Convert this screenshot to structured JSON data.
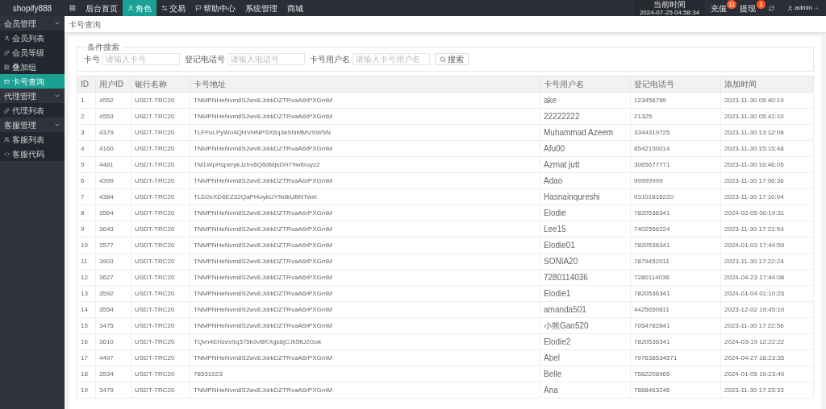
{
  "top_nav": {
    "brand": "shopify888",
    "items": [
      {
        "label": "后台首页",
        "selected": false
      },
      {
        "label": "角色",
        "selected": true
      },
      {
        "label": "交易",
        "selected": false
      },
      {
        "label": "帮助中心",
        "selected": false
      },
      {
        "label": "系统管理",
        "selected": false
      },
      {
        "label": "商城",
        "selected": false
      }
    ],
    "time_label": "当前时间",
    "time": "2024-07-25 04:58:34",
    "actions": [
      {
        "label": "充值",
        "badge": "11"
      },
      {
        "label": "提现",
        "badge": "1"
      }
    ],
    "user": "admin"
  },
  "sidebar": {
    "groups": [
      {
        "label": "会员管理",
        "expanded": true,
        "children": [
          {
            "label": "会员列表",
            "selected": false
          },
          {
            "label": "会员等级",
            "selected": false
          },
          {
            "label": "叠加组",
            "selected": false
          },
          {
            "label": "卡号查询",
            "selected": true
          }
        ]
      },
      {
        "label": "代理管理",
        "expanded": true,
        "children": [
          {
            "label": "代理列表",
            "selected": false
          }
        ]
      },
      {
        "label": "客服管理",
        "expanded": true,
        "children": [
          {
            "label": "客服列表",
            "selected": false
          },
          {
            "label": "客服代码",
            "selected": false
          }
        ]
      }
    ]
  },
  "breadcrumb": "卡号查询",
  "search": {
    "legend": "条件搜索",
    "fields": [
      {
        "label": "卡号",
        "placeholder": "请输入卡号"
      },
      {
        "label": "登记电话号",
        "placeholder": "请输入电话号"
      },
      {
        "label": "卡号用户名",
        "placeholder": "请输入卡号用户名"
      }
    ],
    "button": "搜索"
  },
  "table": {
    "columns": [
      "ID",
      "用户ID",
      "银行名称",
      "卡号地址",
      "卡号用户名",
      "登记电话号",
      "添加时间"
    ],
    "rows": [
      [
        "1",
        "4552",
        "USDT-TRC20",
        "TNMPNHeNvm8S2wvEJdrkDZTRvaA6rPXGmM",
        "ake",
        "123456789",
        "2023-11-30 05:40:19"
      ],
      [
        "2",
        "4553",
        "USDT-TRC20",
        "TNMPNHeNvm8S2wvEJdrkDZTRvaA6rPXGmM",
        "22222222",
        "21325",
        "2023-11-30 05:41:10"
      ],
      [
        "3",
        "4379",
        "USDT-TRC20",
        "TLFFuLPyWo4QNVHNPSX6q3eSNMMVSWSN",
        "Muhammad Azeem",
        "3344319725",
        "2023-11-30 13:12:08"
      ],
      [
        "4",
        "4160",
        "USDT-TRC20",
        "TNMPNHeNvm8S2wvEJdrkDZTRvaA6rPXGmM",
        "Afu00",
        "8542130014",
        "2023-11-30 15:15:48"
      ],
      [
        "5",
        "4481",
        "USDT-TRC20",
        "TM1WpHsperykJzIrv6Q6dMjsDH79w6ruyz2",
        "Azmat jutt",
        "3065677771",
        "2023-11-30 16:46:05"
      ],
      [
        "6",
        "4399",
        "USDT-TRC20",
        "TNMPNHeNvm8S2wvEJdrkDZTRvaA6rPXGmM",
        "Adao",
        "99999999",
        "2023-11-30 17:06:36"
      ],
      [
        "7",
        "4384",
        "USDT-TRC20",
        "TLD2eXD6EZ32QaPt4oykUYNdkUBNTwxt",
        "Hasnainqureshi",
        "03101816220",
        "2023-11-30 17:10:04"
      ],
      [
        "8",
        "3564",
        "USDT-TRC20",
        "TNMPNHeNvm8S2wvEJdrkDZTRvaA6rPXGmM",
        "Elodie",
        "7820536341",
        "2024-02-05 00:19:31"
      ],
      [
        "9",
        "3643",
        "USDT-TRC20",
        "TNMPNHeNvm8S2wvEJdrkDZTRvaA6rPXGmM",
        "Lee15",
        "7402556224",
        "2023-11-30 17:21:54"
      ],
      [
        "10",
        "3577",
        "USDT-TRC20",
        "TNMPNHeNvm8S2wvEJdrkDZTRvaA6rPXGmM",
        "Elodie01",
        "7820536341",
        "2024-01-03 17:44:59"
      ],
      [
        "11",
        "3903",
        "USDT-TRC20",
        "TNMPNHeNvm8S2wvEJdrkDZTRvaA6rPXGmM",
        "SONIA20",
        "7879452011",
        "2023-11-30 17:22:24"
      ],
      [
        "12",
        "3627",
        "USDT-TRC20",
        "TNMPNHeNvm8S2wvEJdrkDZTRvaA6rPXGmM",
        "7280114036",
        "7280114036",
        "2024-04-23 17:44:08"
      ],
      [
        "13",
        "3592",
        "USDT-TRC20",
        "TNMPNHeNvm8S2wvEJdrkDZTRvaA6rPXGmM",
        "Elodie1",
        "7820536341",
        "2024-01-04 01:10:23"
      ],
      [
        "14",
        "3554",
        "USDT-TRC20",
        "TNMPNHeNvm8S2wvEJdrkDZTRvaA6rPXGmM",
        "amanda501",
        "4425650811",
        "2023-12-02 19:45:10"
      ],
      [
        "15",
        "3475",
        "USDT-TRC20",
        "TNMPNHeNvm8S2wvEJdrkDZTRvaA6rPXGmM",
        "小熊Gao520",
        "7054782841",
        "2023-11-30 17:22:56"
      ],
      [
        "16",
        "3610",
        "USDT-TRC20",
        "TQvn4EHzev9q375k9vBKXgs8jCJk5fU2Gok",
        "Elodie2",
        "7820536341",
        "2024-03-19 12:22:22"
      ],
      [
        "17",
        "4497",
        "USDT-TRC20",
        "TNMPNHeNvm8S2wvEJdrkDZTRvaA6rPXGmM",
        "Abel",
        "797638534571",
        "2024-04-27 16:23:35"
      ],
      [
        "18",
        "3534",
        "USDT-TRC20",
        "78531023",
        "Belle",
        "7562208965",
        "2024-01-05 19:23:40"
      ],
      [
        "19",
        "3479",
        "USDT-TRC20",
        "TNMPNHeNvm8S2wvEJdrkDZTRvaA6rPXGmM",
        "Ana",
        "7868463246",
        "2023-11-30 17:23:33"
      ]
    ]
  }
}
